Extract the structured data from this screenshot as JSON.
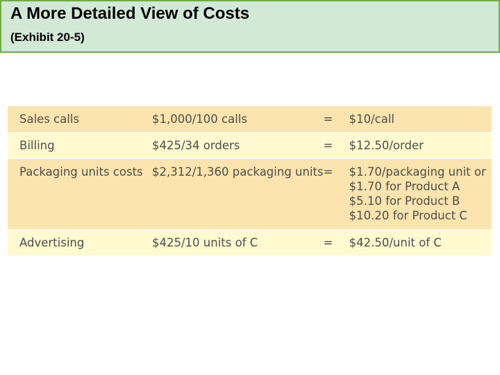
{
  "header": {
    "title": "A More Detailed View of Costs",
    "subtitle": "(Exhibit 20-5)"
  },
  "table": {
    "rows": [
      {
        "item": "Sales calls",
        "calculation": "$1,000/100 calls",
        "equals": "=",
        "result": [
          "$10/call"
        ]
      },
      {
        "item": "Billing",
        "calculation": "$425/34 orders",
        "equals": "=",
        "result": [
          "$12.50/order"
        ]
      },
      {
        "item": "Packaging units costs",
        "calculation": "$2,312/1,360 packaging units",
        "equals": "=",
        "result": [
          "$1.70/packaging unit or",
          "$1.70 for Product A",
          "$5.10 for Product B",
          "$10.20 for Product C"
        ]
      },
      {
        "item": "Advertising",
        "calculation": "$425/10 units of C",
        "equals": "=",
        "result": [
          "$42.50/unit of C"
        ]
      }
    ]
  },
  "colors": {
    "header_background": "#d4e8d6",
    "header_border": "#6cae45",
    "row_shade_dark": "#fbe4ad",
    "row_shade_light": "#fffacf",
    "table_text": "#4d4d4d"
  }
}
